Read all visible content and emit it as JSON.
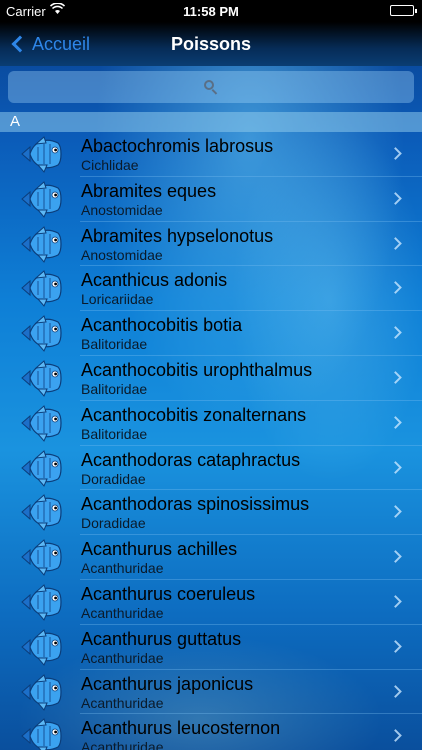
{
  "statusbar": {
    "carrier": "Carrier",
    "time": "11:58 PM"
  },
  "navbar": {
    "back_label": "Accueil",
    "title": "Poissons"
  },
  "search": {
    "placeholder": ""
  },
  "section": {
    "letter": "A"
  },
  "fish": [
    {
      "name": "Abactochromis labrosus",
      "family": "Cichlidae"
    },
    {
      "name": "Abramites eques",
      "family": "Anostomidae"
    },
    {
      "name": "Abramites hypselonotus",
      "family": "Anostomidae"
    },
    {
      "name": "Acanthicus adonis",
      "family": "Loricariidae"
    },
    {
      "name": "Acanthocobitis botia",
      "family": "Balitoridae"
    },
    {
      "name": "Acanthocobitis urophthalmus",
      "family": "Balitoridae"
    },
    {
      "name": "Acanthocobitis zonalternans",
      "family": "Balitoridae"
    },
    {
      "name": "Acanthodoras cataphractus",
      "family": "Doradidae"
    },
    {
      "name": "Acanthodoras spinosissimus",
      "family": "Doradidae"
    },
    {
      "name": "Acanthurus achilles",
      "family": "Acanthuridae"
    },
    {
      "name": "Acanthurus coeruleus",
      "family": "Acanthuridae"
    },
    {
      "name": "Acanthurus guttatus",
      "family": "Acanthuridae"
    },
    {
      "name": "Acanthurus japonicus",
      "family": "Acanthuridae"
    },
    {
      "name": "Acanthurus leucosternon",
      "family": "Acanthuridae"
    }
  ],
  "colors": {
    "accent": "#2e86e8",
    "fish_icon": "#2a8fe6"
  },
  "icons": {
    "back": "chevron-left-icon",
    "search": "search-icon",
    "row": "fish-icon",
    "disclosure": "chevron-right-icon"
  }
}
